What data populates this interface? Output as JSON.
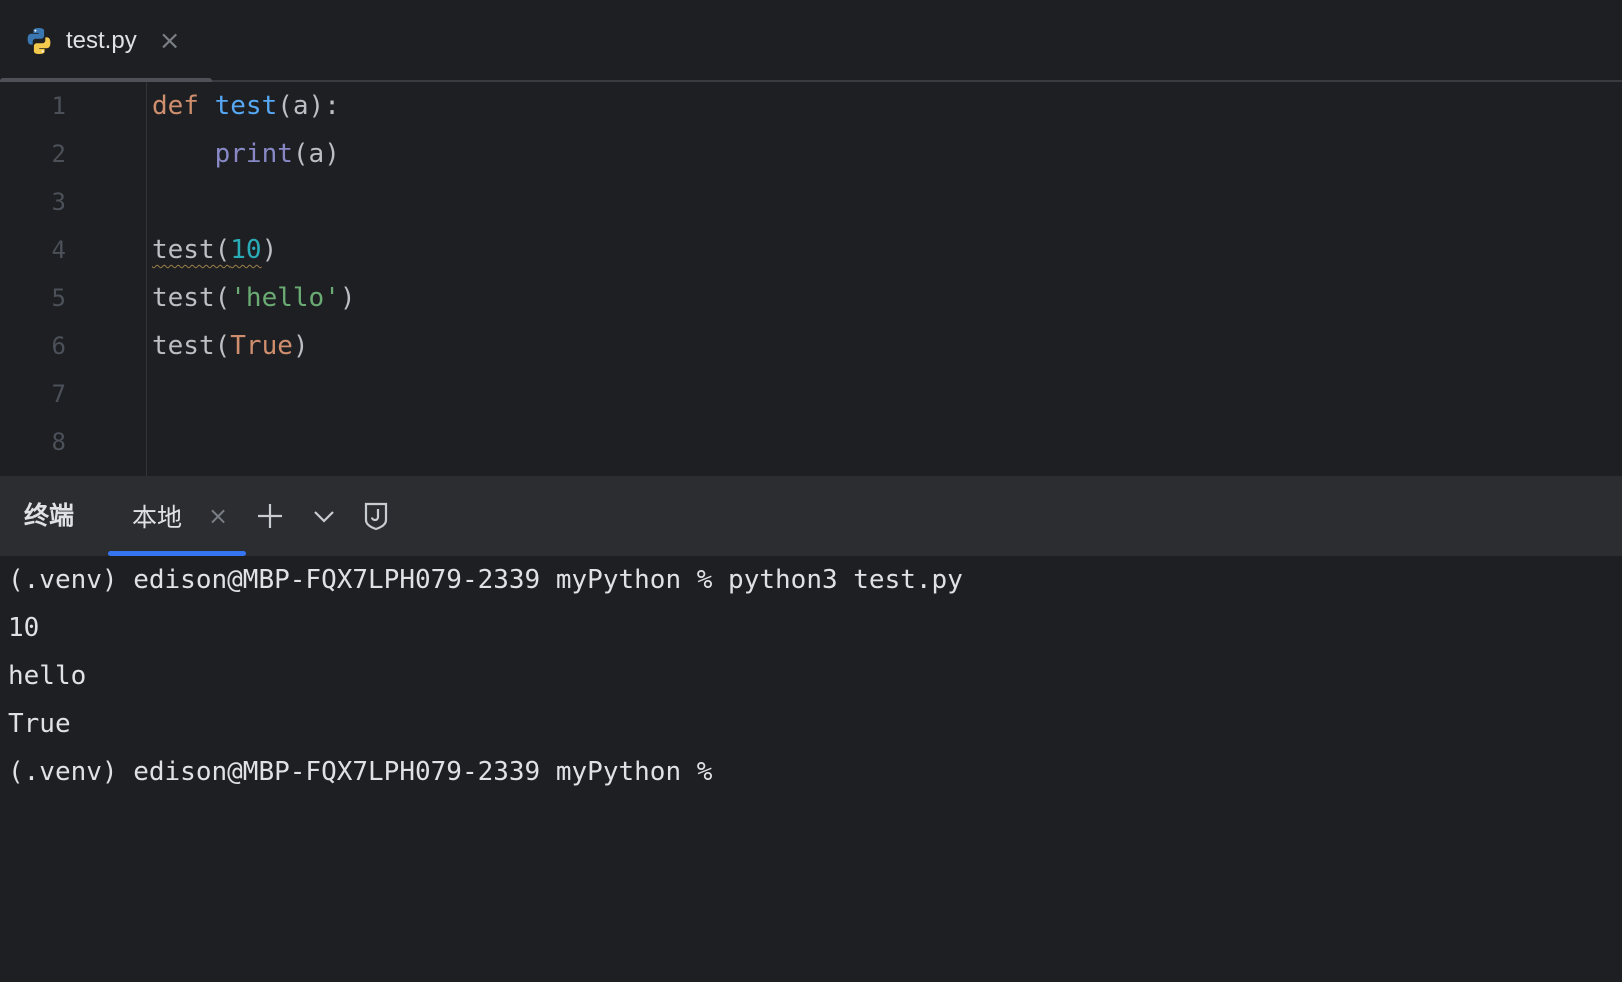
{
  "editor": {
    "tab": {
      "filename": "test.py",
      "close_glyph": "×",
      "icon": "python-icon"
    },
    "line_numbers": [
      "1",
      "2",
      "3",
      "4",
      "5",
      "6",
      "7",
      "8"
    ],
    "lines": [
      {
        "tokens": [
          {
            "t": "def",
            "c": "kw"
          },
          {
            "t": " ",
            "c": ""
          },
          {
            "t": "test",
            "c": "fn"
          },
          {
            "t": "(a):",
            "c": ""
          }
        ]
      },
      {
        "tokens": [
          {
            "t": "    ",
            "c": ""
          },
          {
            "t": "print",
            "c": "builtin"
          },
          {
            "t": "(a)",
            "c": ""
          }
        ]
      },
      {
        "tokens": []
      },
      {
        "tokens": [
          {
            "t": "test(",
            "c": "squiggle"
          },
          {
            "t": "10",
            "c": "num squiggle"
          },
          {
            "t": ")",
            "c": ""
          }
        ]
      },
      {
        "tokens": [
          {
            "t": "test(",
            "c": ""
          },
          {
            "t": "'hello'",
            "c": "str"
          },
          {
            "t": ")",
            "c": ""
          }
        ]
      },
      {
        "tokens": [
          {
            "t": "test(",
            "c": ""
          },
          {
            "t": "True",
            "c": "kw"
          },
          {
            "t": ")",
            "c": ""
          }
        ]
      },
      {
        "tokens": []
      },
      {
        "tokens": []
      }
    ]
  },
  "terminal": {
    "title": "终端",
    "local_tab": {
      "label": "本地",
      "close_glyph": "×"
    },
    "icons": [
      "plus-icon",
      "chevron-down-icon",
      "shield-icon"
    ],
    "output": [
      "(.venv) edison@MBP-FQX7LPH079-2339 myPython % python3 test.py",
      "10",
      "hello",
      "True",
      "(.venv) edison@MBP-FQX7LPH079-2339 myPython %"
    ]
  },
  "colors": {
    "background": "#1e1f22",
    "toolbar": "#2b2d30",
    "keyword": "#cf8e6d",
    "function": "#56a8f5",
    "builtin": "#8888c6",
    "number": "#2aacb8",
    "string": "#6aab73",
    "accent": "#3574f0"
  }
}
